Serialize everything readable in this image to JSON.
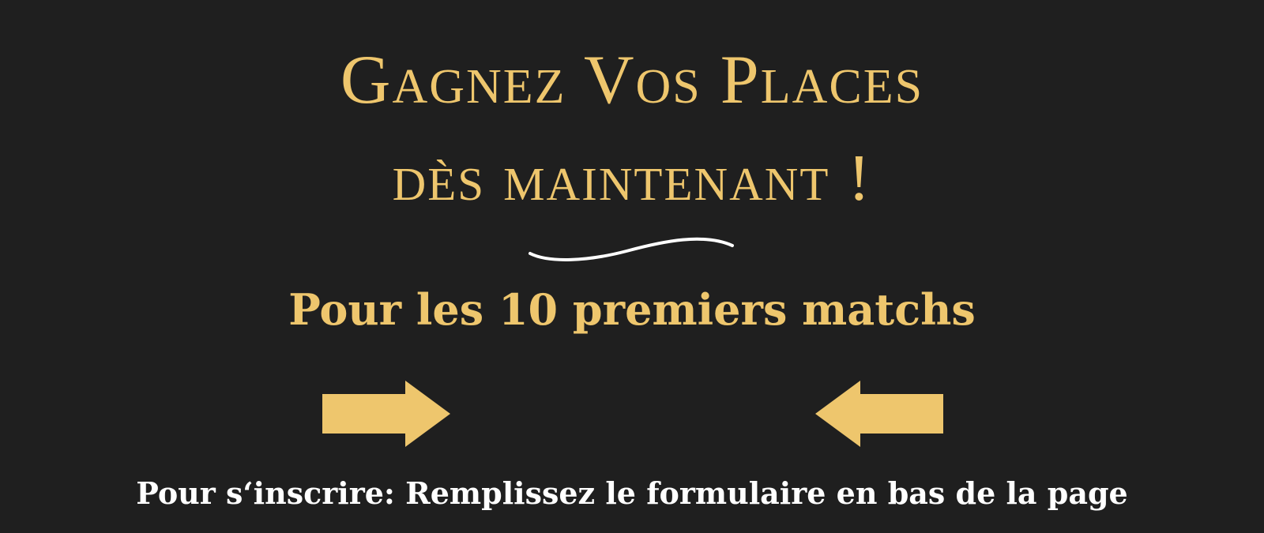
{
  "banner": {
    "headline_line1": "Gagnez Vos Places",
    "headline_line2": "dès maintenant !",
    "subheadline": "Pour les 10 premiers matchs",
    "cta_text": "Pour s‘inscrire: Remplissez le formulaire en bas de la page",
    "icons": {
      "left_arrow": "arrow-right-icon",
      "right_arrow": "arrow-left-icon",
      "divider": "wavy-divider"
    },
    "colors": {
      "background": "#1f1f1f",
      "accent": "#eec66d",
      "text": "#ffffff"
    }
  }
}
